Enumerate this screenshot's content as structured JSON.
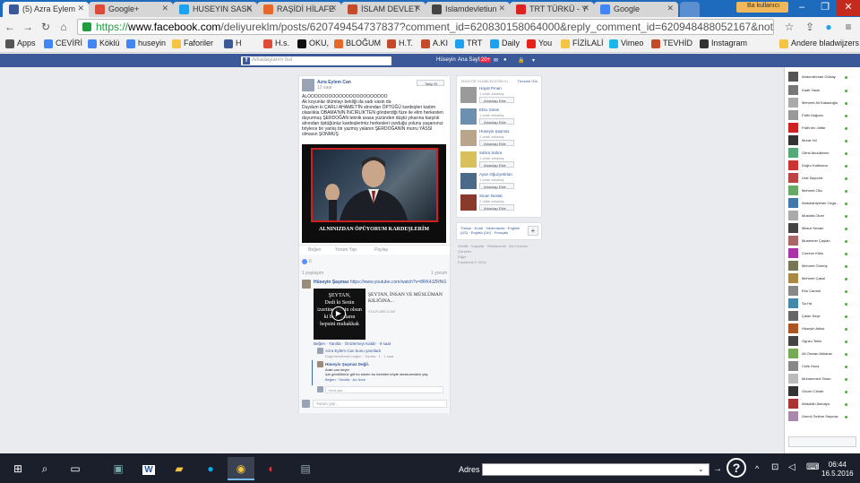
{
  "browser": {
    "tabs": [
      {
        "title": "(5) Azra Eylem",
        "color": "#3b5998",
        "active": true
      },
      {
        "title": "Google+",
        "color": "#dd4b39"
      },
      {
        "title": "HUSEYIN SASK",
        "color": "#1da1f2"
      },
      {
        "title": "RAŞİDİ HİLAFE",
        "color": "#e8672a"
      },
      {
        "title": "İSLAM DEVLET",
        "color": "#c44a2a"
      },
      {
        "title": "Islamdevletiun",
        "color": "#444"
      },
      {
        "title": "TRT TÜRKÜ - Y",
        "color": "#d22"
      },
      {
        "title": "Google",
        "color": "#4285f4"
      }
    ],
    "user_badge": "Ba kullanıcı",
    "url_scheme": "https://",
    "url_host": "www.facebook.com",
    "url_path": "/deliyureklm/posts/620749454737837?comment_id=620830158064000&reply_comment_id=620948488052167&notif_t=fee",
    "bookmarks": [
      {
        "label": "Apps",
        "color": "#555"
      },
      {
        "label": "CEVİRİ",
        "color": "#4285f4"
      },
      {
        "label": "Köklü",
        "color": "#4285f4"
      },
      {
        "label": "huseyin",
        "color": "#4285f4"
      },
      {
        "label": "Faforiler",
        "color": "#f4c542"
      },
      {
        "label": "H",
        "color": "#3b5998"
      },
      {
        "label": "H.s.",
        "color": "#dd4b39"
      },
      {
        "label": "OKU,",
        "color": "#111"
      },
      {
        "label": "BLOĞUM",
        "color": "#e8672a"
      },
      {
        "label": "H.T.",
        "color": "#c44a2a"
      },
      {
        "label": "A.KI",
        "color": "#c44a2a"
      },
      {
        "label": "TRT",
        "color": "#1da1f2"
      },
      {
        "label": "Daily",
        "color": "#1da1f2"
      },
      {
        "label": "You",
        "color": "#e62117"
      },
      {
        "label": "FİZİLALİ",
        "color": "#f4c542"
      },
      {
        "label": "Vimeo",
        "color": "#1ab7ea"
      },
      {
        "label": "TEVHİD",
        "color": "#c44a2a"
      },
      {
        "label": "Instagram",
        "color": "#333"
      },
      {
        "label": "Andere bladwijzers",
        "color": "#f4c542"
      }
    ]
  },
  "facebook": {
    "search_placeholder": "Arkadaşlarını bul",
    "nav": [
      "Hüseyin",
      "Ana Sayfa",
      "20+"
    ],
    "post": {
      "author": "Azra Eylem Can",
      "time": "13 saat · ",
      "follow": "Takip Et",
      "text_lines": [
        "ALOOOOOOOOOOOOOOOOOOOOOOO",
        "Ak koyunlar ölümlayı bekliği da sadı vasin da",
        "Duydum ki ÇARLI AHAMET'İN alnından ÖPTÜĞÜ kardeşleri kadım",
        "olasılıkla OBAMA'NIN İNCİRLİK'TEN gönderdiği füze ile elim herkesten",
        "duyurmuş ŞERDOĞAN teknik arasa yüzünden düştü yıkarına karşılık",
        "alnından öptüğünüz kardeşlerimiz herkesleri vurduğu yolunu yaşarsınız",
        "böylece bir yanlış bir yazmış yalanın ŞERDOĞANIN murru YASSI",
        "olmasın ŞONMUŞ"
      ],
      "image_caption": "ALNINIZDAN ÖPÜYORUM KARDEŞLERİM",
      "actions": [
        "Beğen",
        "Yorum Yap",
        "Paylaş"
      ],
      "likes": "6",
      "shares": "1 paylaşım",
      "comment_count": "1 yorum",
      "comment_author": "Hüseyin Şaşmaz",
      "comment_link": "https://www.youtube.com/watch?v=8RK4JZRNG",
      "video_lines": [
        "ŞEYTAN,",
        "Dedi ki Senin",
        "izzetine yemin olsun",
        "ki ben, onların",
        "hepsini muhakkak"
      ],
      "video_title": "ŞEYTAN, İNSAN VE MÜSLÜMAN KILIĞINA...",
      "video_source": "YOUTUBE.COM",
      "comment_actions": "Beğen · Yanıtla · Önizlemeyi Kaldır · 9 saat",
      "reply_line": "Azra Eylem Can bunu yanıtladı",
      "reply_sub": "Değerlendirmek beğen · Yanıtla · 1 · 1 saat",
      "reply2_author": "Hüseyin Şaşmaz Değil.",
      "reply2_text1": "Arab can deyin",
      "reply2_text2": "için gönüllünüz göt bu sözen bu özelden böyle mezkurmaktır yaş",
      "reply2_actions": "Beğen · Yanıtla · Az önce",
      "reply_placeholder": "Yanıt yaz...",
      "comment_placeholder": "Yorum yaz..."
    },
    "suggestions": {
      "header": "TANIYOR OLABİLECEĞİN Kİ...",
      "see_all": "Tümünü Gör",
      "add_label": "Arkadaşı Ekle",
      "people": [
        {
          "name": "Hayat Pınarı",
          "sub": "1 ortak arkadaş",
          "color": "#9a9a9a"
        },
        {
          "name": "Ebru Sinan",
          "sub": "1 ortak arkadaş",
          "color": "#6d8fb0"
        },
        {
          "name": "Hüseyin Şaşmaz",
          "sub": "2 ortak arkadaş",
          "color": "#b9a58a"
        },
        {
          "name": "Sahra Sahra",
          "sub": "1 ortak arkadaş",
          "color": "#d8c15a"
        },
        {
          "name": "Ayan Oğuzyetirtan",
          "sub": "1 ortak arkadaş",
          "color": "#4b6a8a"
        },
        {
          "name": "Sinan Nostal",
          "sub": "2 ortak arkadaş",
          "color": "#8a3a2a"
        }
      ]
    },
    "language": {
      "current": "Türkçe",
      "others": "Kurdî · Nederlands · English (US) · English (UK) · Français"
    },
    "footer": [
      "Gizlilik · Koşullar · Reklamcılık · Ad Choices · Çerezler",
      "Diğer",
      "Facebook © 2016"
    ],
    "chat_contacts": [
      {
        "name": "Abdurrahman Gülsay",
        "color": "#555"
      },
      {
        "name": "Kadir Yasik",
        "color": "#777"
      },
      {
        "name": "Mehmet Ali Kabaduğlu",
        "color": "#aaa"
      },
      {
        "name": "Fatih Dağcan",
        "color": "#999"
      },
      {
        "name": "Fatih bin Jaffar",
        "color": "#c22"
      },
      {
        "name": "Murat Yel",
        "color": "#333"
      },
      {
        "name": "Oltral Abdulkerim",
        "color": "#5a7"
      },
      {
        "name": "Doğru Kalbinma",
        "color": "#c33"
      },
      {
        "name": "Ural Sayıcılık",
        "color": "#b44"
      },
      {
        "name": "Mehmet Oltu",
        "color": "#6a6"
      },
      {
        "name": "Abdullahiyehan Ozga...",
        "color": "#47a"
      },
      {
        "name": "Mustafa Oluer",
        "color": "#aaa"
      },
      {
        "name": "Mesut Yaman",
        "color": "#444"
      },
      {
        "name": "Muammer Çaylan",
        "color": "#a66"
      },
      {
        "name": "Cumhur Kilim",
        "color": "#a3a"
      },
      {
        "name": "Mehmet Gümüş",
        "color": "#775"
      },
      {
        "name": "Mehmet Çakal",
        "color": "#a84"
      },
      {
        "name": "Ebu Camlal",
        "color": "#888"
      },
      {
        "name": "Sa Ha",
        "color": "#48a"
      },
      {
        "name": "Çalan Seçk",
        "color": "#666"
      },
      {
        "name": "Hüseyin Akkut",
        "color": "#a52"
      },
      {
        "name": "Oguzu Tekin",
        "color": "#444"
      },
      {
        "name": "Ali Osman Akkaraz",
        "color": "#7a5"
      },
      {
        "name": "Celik Hoca",
        "color": "#888"
      },
      {
        "name": "Muhammed Sinan",
        "color": "#bbb"
      },
      {
        "name": "Güven Cimah",
        "color": "#333"
      },
      {
        "name": "Abdullah Akmaya",
        "color": "#a33"
      },
      {
        "name": "Ümmü Selime Saçmaz",
        "color": "#a8a"
      }
    ]
  },
  "taskbar": {
    "address_label": "Adres",
    "time": "06:44",
    "date": "16.5.2016"
  }
}
